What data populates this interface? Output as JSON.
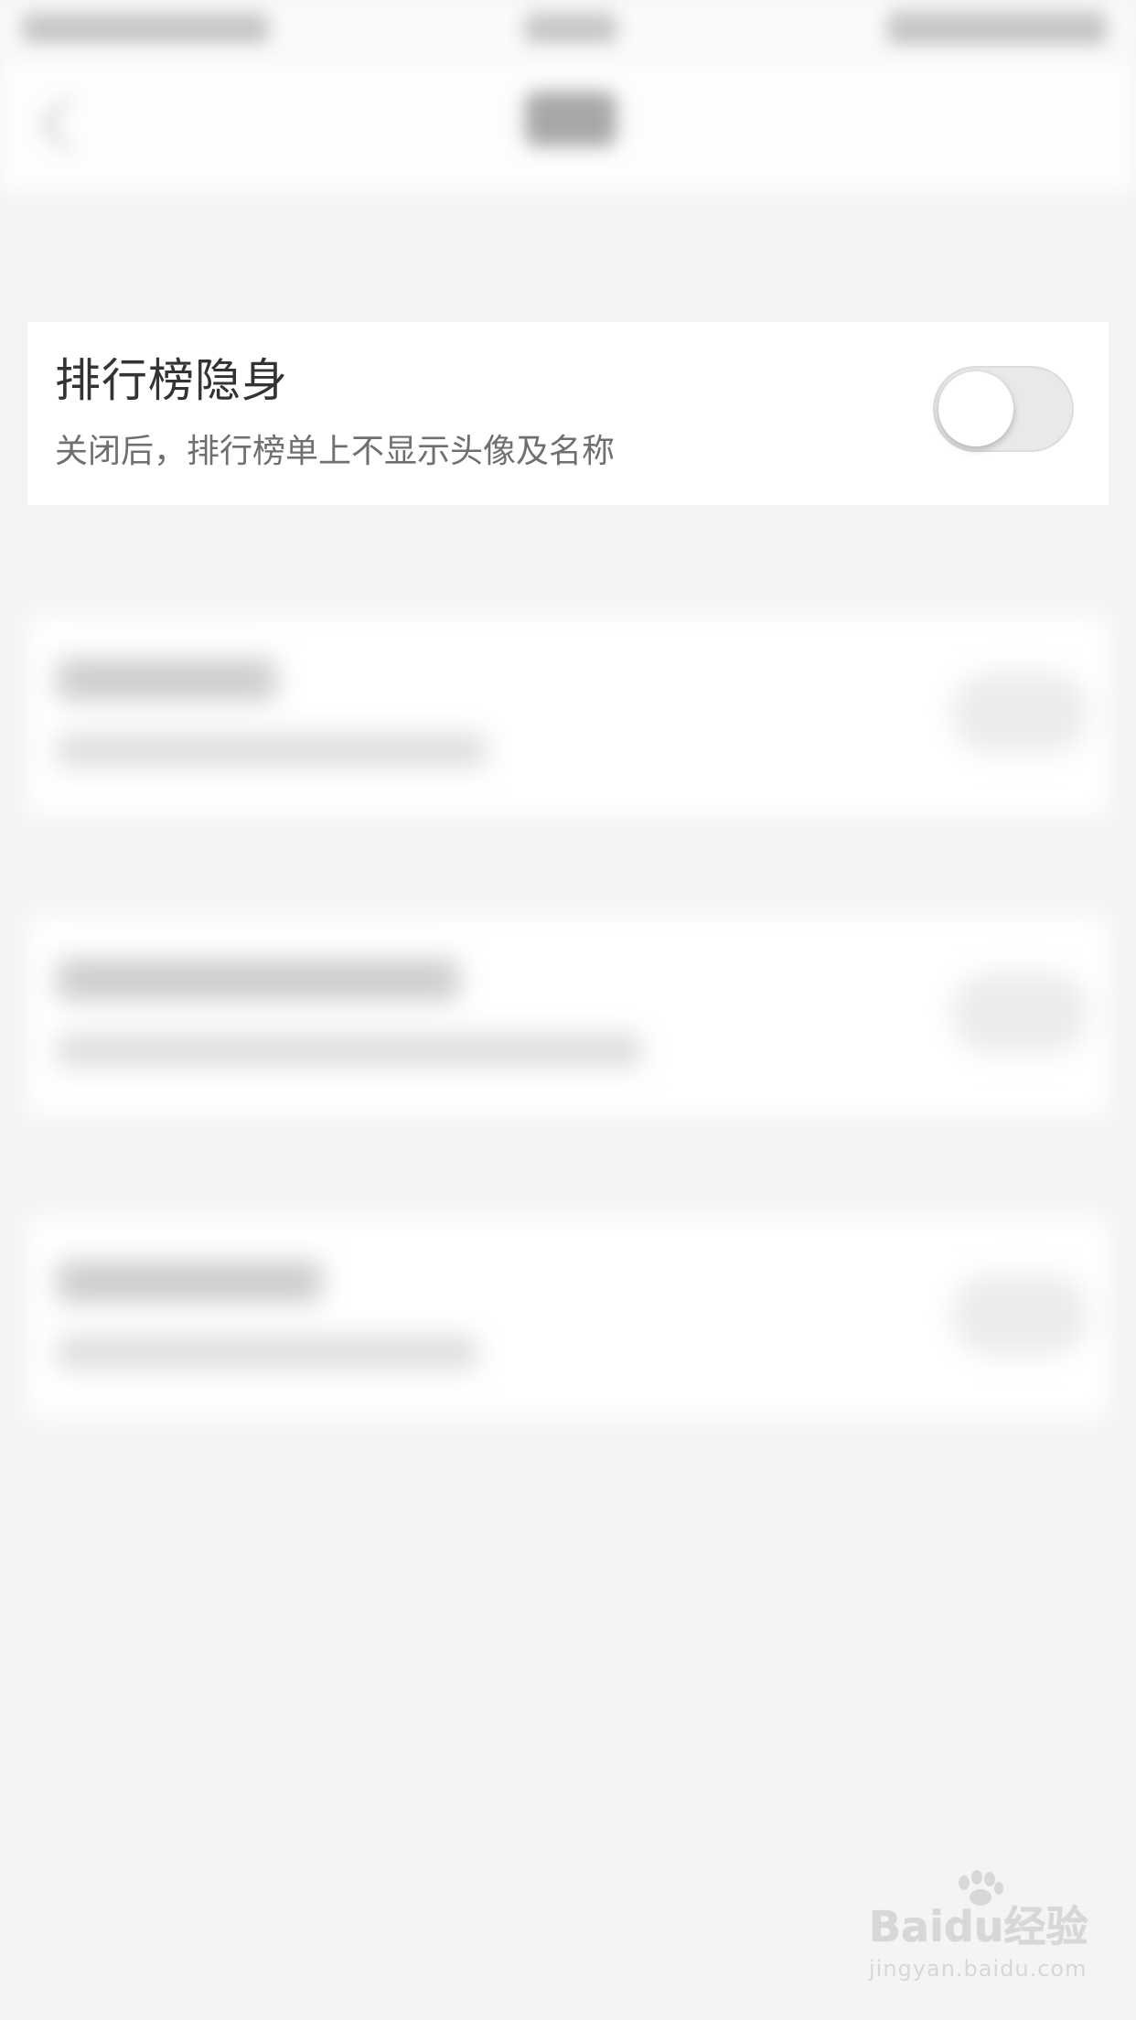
{
  "setting": {
    "title": "排行榜隐身",
    "description": "关闭后，排行榜单上不显示头像及名称",
    "toggle_state": "off"
  },
  "watermark": {
    "logo": "Baidu经验",
    "url": "jingyan.baidu.com"
  },
  "colors": {
    "background": "#f4f4f4",
    "card": "#ffffff",
    "title_text": "#333333",
    "desc_text": "#6f6f6f",
    "toggle_track_off": "#e9e9ea"
  }
}
